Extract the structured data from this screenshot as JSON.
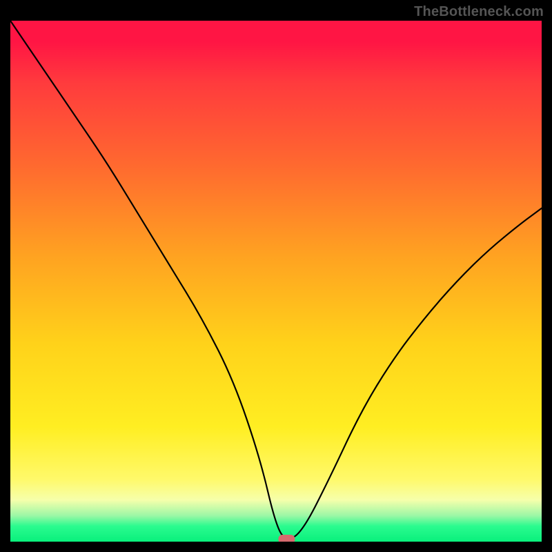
{
  "watermark": "TheBottleneck.com",
  "colors": {
    "frame": "#000000",
    "curve": "#000000",
    "marker": "#d66a6e",
    "gradient_stops": [
      "#ff1544",
      "#ff3b3d",
      "#ff6a2f",
      "#ffa221",
      "#ffd21a",
      "#ffee22",
      "#fff96a",
      "#f6ffab",
      "#9cf7a6",
      "#2bfb8f",
      "#09f07c"
    ]
  },
  "chart_data": {
    "type": "line",
    "title": "",
    "xlabel": "",
    "ylabel": "",
    "xlim": [
      0,
      100
    ],
    "ylim": [
      0,
      100
    ],
    "legend": false,
    "grid": false,
    "annotations": [
      {
        "type": "marker",
        "x": 52,
        "y": 0,
        "shape": "rounded-rect"
      }
    ],
    "series": [
      {
        "name": "bottleneck-curve",
        "x": [
          0,
          6,
          12,
          18,
          24,
          30,
          36,
          42,
          47,
          50,
          52,
          55,
          60,
          66,
          72,
          78,
          84,
          90,
          96,
          100
        ],
        "y": [
          100,
          91,
          82,
          73,
          63,
          53,
          43,
          31,
          16,
          3,
          0,
          2,
          12,
          25,
          35,
          43,
          50,
          56,
          61,
          64
        ]
      }
    ],
    "background_gradient": {
      "direction": "vertical",
      "stops": [
        {
          "pos": 0.0,
          "color": "#ff1544"
        },
        {
          "pos": 0.12,
          "color": "#ff3b3d"
        },
        {
          "pos": 0.28,
          "color": "#ff6a2f"
        },
        {
          "pos": 0.45,
          "color": "#ffa221"
        },
        {
          "pos": 0.62,
          "color": "#ffd21a"
        },
        {
          "pos": 0.78,
          "color": "#ffee22"
        },
        {
          "pos": 0.88,
          "color": "#fff96a"
        },
        {
          "pos": 0.92,
          "color": "#f6ffab"
        },
        {
          "pos": 0.95,
          "color": "#9cf7a6"
        },
        {
          "pos": 0.97,
          "color": "#2bfb8f"
        },
        {
          "pos": 1.0,
          "color": "#09f07c"
        }
      ]
    }
  }
}
